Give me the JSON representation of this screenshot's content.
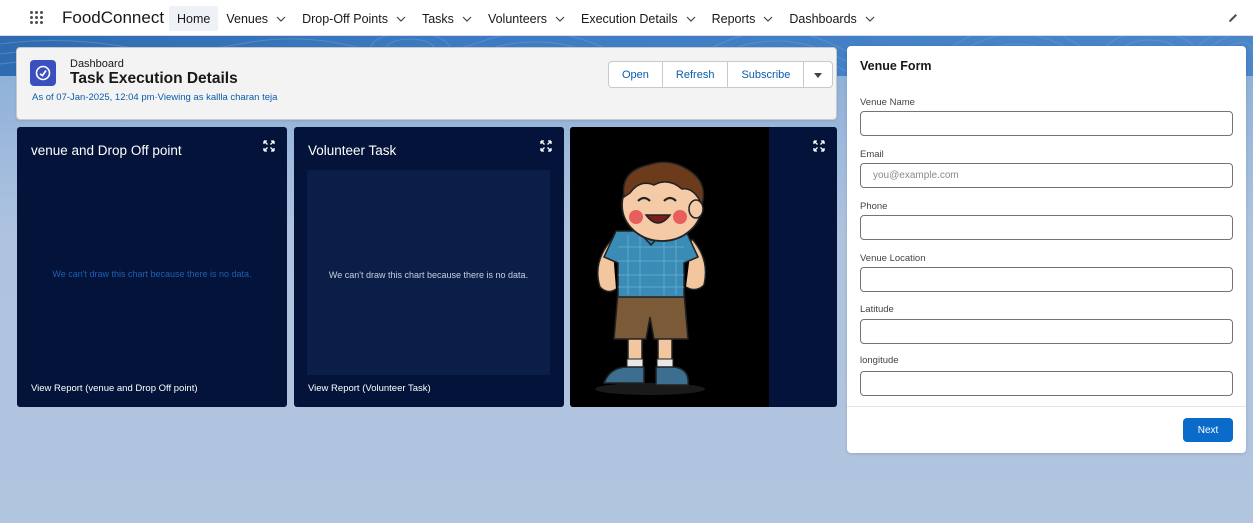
{
  "app": {
    "name": "FoodConnect",
    "nav": [
      {
        "label": "Home",
        "active": true,
        "has_menu": false
      },
      {
        "label": "Venues",
        "active": false,
        "has_menu": true
      },
      {
        "label": "Drop-Off Points",
        "active": false,
        "has_menu": true
      },
      {
        "label": "Tasks",
        "active": false,
        "has_menu": true
      },
      {
        "label": "Volunteers",
        "active": false,
        "has_menu": true
      },
      {
        "label": "Execution Details",
        "active": false,
        "has_menu": true
      },
      {
        "label": "Reports",
        "active": false,
        "has_menu": true
      },
      {
        "label": "Dashboards",
        "active": false,
        "has_menu": true
      }
    ],
    "icons": {
      "launcher": "app-launcher-icon",
      "edit": "pencil-icon"
    }
  },
  "dashboard": {
    "kicker": "Dashboard",
    "title": "Task Execution Details",
    "as_of": "As of 07-Jan-2025, 12:04 pm·Viewing as kallla charan teja",
    "buttons": {
      "open": "Open",
      "refresh": "Refresh",
      "subscribe": "Subscribe"
    }
  },
  "cards": {
    "venue": {
      "title": "venue and Drop Off point",
      "no_data": "We can't draw this chart because there is no data.",
      "link": "View Report (venue and Drop Off point)"
    },
    "volunteer": {
      "title": "Volunteer Task",
      "no_data": "We can't draw this chart because there is no data.",
      "link": "View Report (Volunteer Task)"
    },
    "image": {
      "alt": "cartoon boy"
    }
  },
  "form": {
    "title": "Venue Form",
    "fields": [
      {
        "label": "Venue Name",
        "placeholder": ""
      },
      {
        "label": "Email",
        "placeholder": "you@example.com"
      },
      {
        "label": "Phone",
        "placeholder": ""
      },
      {
        "label": "Venue Location",
        "placeholder": ""
      },
      {
        "label": "Latitude",
        "placeholder": ""
      },
      {
        "label": "longitude",
        "placeholder": ""
      }
    ],
    "next": "Next"
  },
  "colors": {
    "brand": "#0b6bcb",
    "card_bg": "#03133a",
    "link": "#0b5cab"
  }
}
